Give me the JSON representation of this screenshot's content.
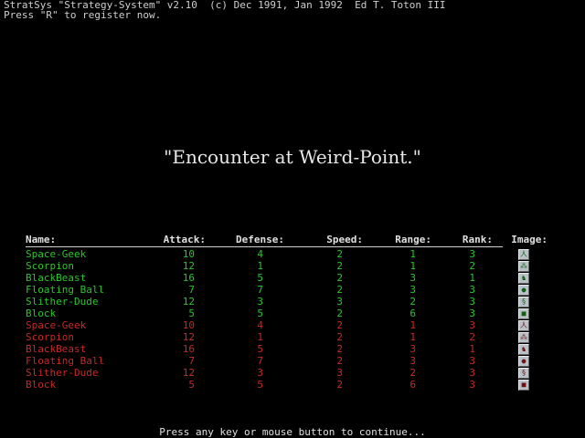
{
  "header": {
    "line1": "StratSys \"Strategy-System\" v2.10  (c) Dec 1991, Jan 1992  Ed T. Toton III",
    "line2": "Press \"R\" to register now."
  },
  "title": "\"Encounter at Weird-Point.\"",
  "columns": {
    "name": "Name:",
    "attack": "Attack:",
    "defense": "Defense:",
    "speed": "Speed:",
    "range": "Range:",
    "rank": "Rank:",
    "image": "Image:"
  },
  "units": [
    {
      "name": "Space-Geek",
      "attack": "10",
      "defense": "4",
      "speed": "2",
      "range": "1",
      "rank": "3",
      "team": "green",
      "icon": "space-geek-icon",
      "glyph": "人"
    },
    {
      "name": "Scorpion",
      "attack": "12",
      "defense": "1",
      "speed": "2",
      "range": "1",
      "rank": "2",
      "team": "green",
      "icon": "scorpion-icon",
      "glyph": "⁂"
    },
    {
      "name": "BlackBeast",
      "attack": "16",
      "defense": "5",
      "speed": "2",
      "range": "3",
      "rank": "1",
      "team": "green",
      "icon": "black-beast-icon",
      "glyph": "♞"
    },
    {
      "name": "Floating Ball",
      "attack": "7",
      "defense": "7",
      "speed": "2",
      "range": "3",
      "rank": "3",
      "team": "green",
      "icon": "floating-ball-icon",
      "glyph": "●"
    },
    {
      "name": "Slither-Dude",
      "attack": "12",
      "defense": "3",
      "speed": "3",
      "range": "2",
      "rank": "3",
      "team": "green",
      "icon": "slither-dude-icon",
      "glyph": "§"
    },
    {
      "name": "Block",
      "attack": "5",
      "defense": "5",
      "speed": "2",
      "range": "6",
      "rank": "3",
      "team": "green",
      "icon": "block-icon",
      "glyph": "■"
    },
    {
      "name": "Space-Geek",
      "attack": "10",
      "defense": "4",
      "speed": "2",
      "range": "1",
      "rank": "3",
      "team": "red",
      "icon": "space-geek-icon",
      "glyph": "人"
    },
    {
      "name": "Scorpion",
      "attack": "12",
      "defense": "1",
      "speed": "2",
      "range": "1",
      "rank": "2",
      "team": "red",
      "icon": "scorpion-icon",
      "glyph": "⁂"
    },
    {
      "name": "BlackBeast",
      "attack": "16",
      "defense": "5",
      "speed": "2",
      "range": "3",
      "rank": "1",
      "team": "red",
      "icon": "black-beast-icon",
      "glyph": "♞"
    },
    {
      "name": "Floating Ball",
      "attack": "7",
      "defense": "7",
      "speed": "2",
      "range": "3",
      "rank": "3",
      "team": "red",
      "icon": "floating-ball-icon",
      "glyph": "●"
    },
    {
      "name": "Slither-Dude",
      "attack": "12",
      "defense": "3",
      "speed": "3",
      "range": "2",
      "rank": "3",
      "team": "red",
      "icon": "slither-dude-icon",
      "glyph": "§"
    },
    {
      "name": "Block",
      "attack": "5",
      "defense": "5",
      "speed": "2",
      "range": "6",
      "rank": "3",
      "team": "red",
      "icon": "block-icon",
      "glyph": "■"
    }
  ],
  "colors": {
    "green_team": "#28c828",
    "red_team": "#c82828",
    "text": "#cfcfcf"
  },
  "footer": "Press any key or mouse button to continue..."
}
